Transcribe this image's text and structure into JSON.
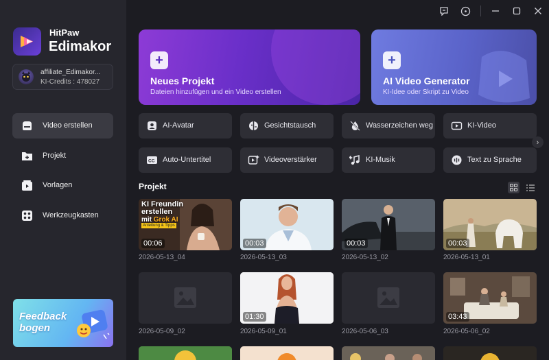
{
  "app": {
    "brand_line1": "HitPaw",
    "brand_line2": "Edimakor"
  },
  "account": {
    "name": "affiliate_Edimakor...",
    "credits": "KI-Credits : 478027"
  },
  "nav": [
    {
      "label": "Video erstellen",
      "icon": "video-create-icon",
      "active": true
    },
    {
      "label": "Projekt",
      "icon": "folder-icon",
      "active": false
    },
    {
      "label": "Vorlagen",
      "icon": "template-icon",
      "active": false
    },
    {
      "label": "Werkzeugkasten",
      "icon": "toolbox-icon",
      "active": false
    }
  ],
  "feedback": {
    "label": "Feedback bogen"
  },
  "hero": [
    {
      "title": "Neues Projekt",
      "subtitle": "Dateien hinzufügen und ein Video erstellen"
    },
    {
      "title": "AI Video Generator",
      "subtitle": "KI-Idee oder Skript zu Video"
    }
  ],
  "tools": [
    {
      "label": "AI-Avatar",
      "icon": "avatar-icon"
    },
    {
      "label": "Gesichtstausch",
      "icon": "face-swap-icon"
    },
    {
      "label": "Wasserzeichen weg",
      "icon": "watermark-remove-icon"
    },
    {
      "label": "KI-Video",
      "icon": "ai-video-icon"
    },
    {
      "label": "Auto-Untertitel",
      "icon": "subtitle-icon"
    },
    {
      "label": "Videoverstärker",
      "icon": "video-enhance-icon"
    },
    {
      "label": "KI-Musik",
      "icon": "music-icon"
    },
    {
      "label": "Text zu Sprache",
      "icon": "text-to-speech-icon"
    }
  ],
  "projects_section": {
    "title": "Projekt"
  },
  "thumb_text": {
    "line1": "KI Freundin",
    "line2": "erstellen",
    "line3": "mit",
    "line3_accent": "Grok AI",
    "badge": "Anleitung & Tipps"
  },
  "projects": [
    {
      "name": "2026-05-13_04",
      "duration": "00:06"
    },
    {
      "name": "2026-05-13_03",
      "duration": "00:03"
    },
    {
      "name": "2026-05-13_02",
      "duration": "00:03"
    },
    {
      "name": "2026-05-13_01",
      "duration": "00:03"
    },
    {
      "name": "2026-05-09_02",
      "duration": ""
    },
    {
      "name": "2026-05-09_01",
      "duration": "01:30"
    },
    {
      "name": "2026-05-06_03",
      "duration": ""
    },
    {
      "name": "2026-05-06_02",
      "duration": "03:43"
    }
  ],
  "colors": {
    "accent_purple": "#7a35d2",
    "accent_blue": "#5a63c9",
    "sidebar_bg": "#26262d",
    "main_bg": "#1c1c22"
  }
}
